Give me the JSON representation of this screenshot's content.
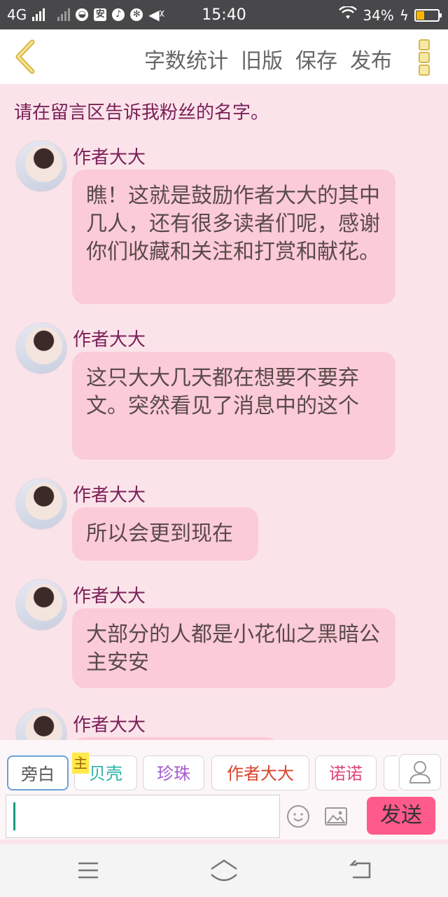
{
  "status_bar": {
    "network": "4G",
    "time": "15:40",
    "battery": "34%",
    "battery_level": 0.34
  },
  "header": {
    "word_count": "字数统计",
    "old_version": "旧版",
    "save": "保存",
    "publish": "发布"
  },
  "notice": "请在留言区告诉我粉丝的名字。",
  "messages": [
    {
      "sender": "作者大大",
      "text": "瞧！这就是鼓励作者大大的其中几人，还有很多读者们呢，感谢你们收藏和关注和打赏和献花。"
    },
    {
      "sender": "作者大大",
      "text": "这只大大几天都在想要不要弃文。突然看见了消息中的这个"
    },
    {
      "sender": "作者大大",
      "text": "所以会更到现在"
    },
    {
      "sender": "作者大大",
      "text": "大部分的人都是小花仙之黑暗公主安安"
    },
    {
      "sender": "作者大大",
      "text": ""
    }
  ],
  "roles": {
    "narration": "旁白",
    "main_badge": "主",
    "beike": "贝壳",
    "zhenzhu": "珍珠",
    "author": "作者大大",
    "nuonuo": "诺诺"
  },
  "composer": {
    "input_value": "",
    "send": "发送"
  },
  "colors": {
    "page_bg": "#fbe3ea",
    "bubble_bg": "#fccbd8",
    "accent_name": "#7a1f57",
    "send_button": "#ff5a8c"
  }
}
